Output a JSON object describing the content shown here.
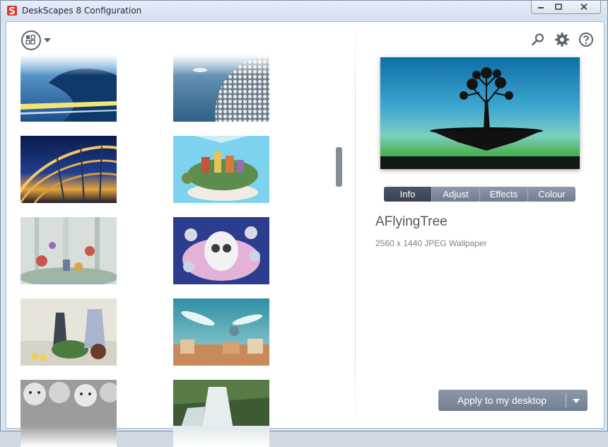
{
  "window": {
    "title": "DeskScapes 8 Configuration"
  },
  "toolbar": {
    "view_icon": "grid-view-icon",
    "search_icon": "search-icon",
    "settings_icon": "gear-icon",
    "help_icon": "help-icon"
  },
  "gallery": {
    "items": [
      "blue-architecture",
      "silver-dome-building",
      "tunnel-sunset",
      "flying-turtle-island",
      "fantasy-forest",
      "cartoon-creatures",
      "toy-figures",
      "flying-robot-town",
      "stone-faces",
      "waterfall"
    ]
  },
  "preview": {
    "image": "a-flying-tree"
  },
  "tabs": [
    {
      "label": "Info",
      "active": true
    },
    {
      "label": "Adjust",
      "active": false
    },
    {
      "label": "Effects",
      "active": false
    },
    {
      "label": "Colour",
      "active": false
    }
  ],
  "info": {
    "name": "AFlyingTree",
    "details": "2560 x 1440 JPEG Wallpaper"
  },
  "apply": {
    "label": "Apply to my desktop"
  },
  "colors": {
    "accent": "#7b8797",
    "active_tab": "#3f4a59"
  }
}
